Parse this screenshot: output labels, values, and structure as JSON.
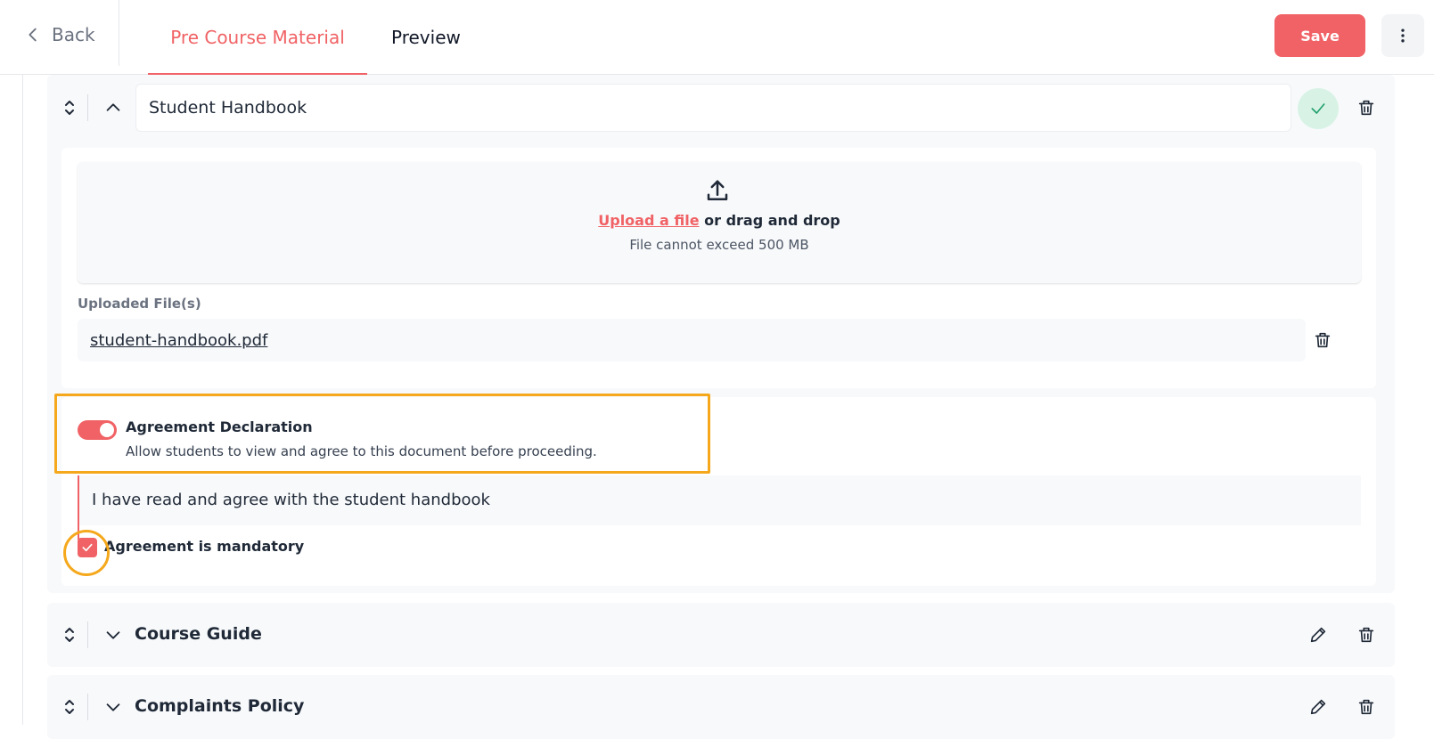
{
  "header": {
    "back_label": "Back",
    "tabs": [
      {
        "label": "Pre Course Material",
        "active": true
      },
      {
        "label": "Preview",
        "active": false
      }
    ],
    "save_label": "Save"
  },
  "colors": {
    "accent": "#f06265",
    "highlight": "#f5a81c",
    "success_bg": "#d8f3e6",
    "success_check": "#22a06b"
  },
  "sections": {
    "open": {
      "title_value": "Student Handbook",
      "upload": {
        "link_text": "Upload a file",
        "rest_text": " or drag and drop",
        "limit_text": "File cannot exceed 500 MB"
      },
      "uploaded_label": "Uploaded File(s)",
      "files": [
        {
          "name": "student-handbook.pdf"
        }
      ],
      "agreement": {
        "enabled": true,
        "title": "Agreement Declaration",
        "description": "Allow students to view and agree to this document before proceeding.",
        "text": "I have read and agree with the student handbook",
        "mandatory_checked": true,
        "mandatory_label": "Agreement is mandatory"
      }
    },
    "collapsed": [
      {
        "title": "Course Guide"
      },
      {
        "title": "Complaints Policy"
      }
    ]
  }
}
